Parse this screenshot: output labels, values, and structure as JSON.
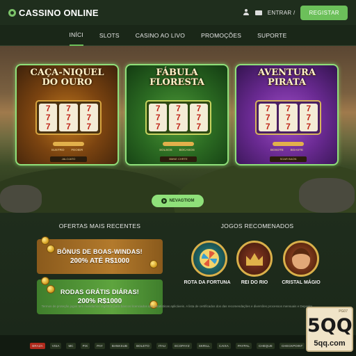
{
  "header": {
    "logo_text": "CASSINO ONLINE",
    "login_label": "ENTRAR /",
    "register_label": "REGISTAR"
  },
  "nav": {
    "items": [
      "INÍCI",
      "SLOTS",
      "CASINO AO LIVO",
      "PROMOÇÕES",
      "SUPORTE"
    ],
    "active_index": 0
  },
  "hero": {
    "cards": [
      {
        "title_line1": "CAÇA-NIQUEL",
        "title_line2": "DO OURO",
        "sub_left": "SUSTRO",
        "sub_right": "FEOIER",
        "button": "JALOJATO"
      },
      {
        "title_line1": "FÁBULA",
        "title_line2": "FLORESTA",
        "sub_left": "SOLSOS",
        "sub_right": "BOCASOS",
        "button": "BMNE CHRTE"
      },
      {
        "title_line1": "AVENTURA",
        "title_line2": "PIRATA",
        "sub_left": "BOSOTE",
        "sub_right": "BOASTE",
        "button": "SOAR BAON"
      }
    ],
    "cta_label": "NEVAGTIOM"
  },
  "offers": {
    "title": "OFERTAS MAIS RECENTES",
    "items": [
      {
        "line1": "BÔNUS DE BOAS-WINDAS!",
        "line2": "200% ATÉ R$1000"
      },
      {
        "line1": "RODAS GRÁTIS DIÁRAS!",
        "line2": "200% R$1000"
      }
    ]
  },
  "recommended": {
    "title": "JOGOS RECOMENADOS",
    "games": [
      {
        "label": "ROTA DA FORTUNA",
        "icon": "wheel-icon"
      },
      {
        "label": "REI DO RIO",
        "icon": "crown-icon"
      },
      {
        "label": "CRISTAL MÁGIO",
        "icon": "face-icon"
      }
    ]
  },
  "disclaimer": "Termos de proteção jogos tem mandamos registros para bancos licenciados das estatísticas aplicáveis. A lista de certificados dos das recomendações e diversões processos mensuais e Deposito.",
  "footer": {
    "payment_logos": [
      "BRAZA",
      "VISA",
      "MC",
      "PIX",
      "PAY",
      "BANKSUB",
      "BOLETO",
      "ITAU",
      "ECOPAYZ",
      "SKRILL",
      "CAIXA",
      "PAYPAL",
      "CHEQUE",
      "CHECKPOINT",
      "SHIVER"
    ]
  },
  "badge": {
    "small": "PG07",
    "big": "5QQ",
    "url": "5qq.com"
  },
  "colors": {
    "accent": "#6cc05a",
    "card_border": "#8fe07a",
    "background": "#1c2a1a"
  }
}
